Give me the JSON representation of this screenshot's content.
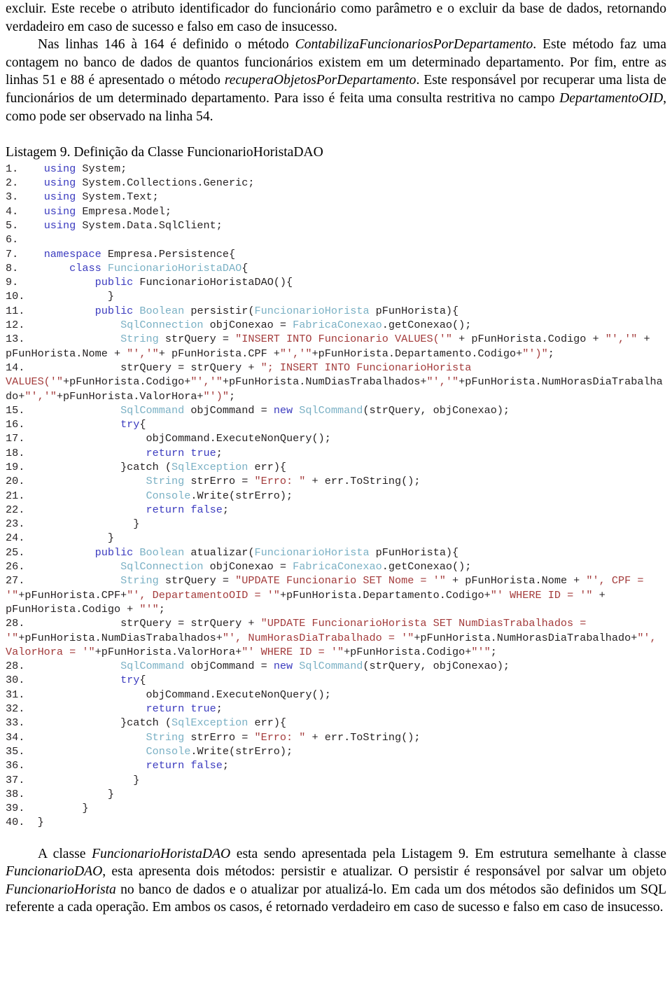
{
  "colors": {
    "keyword": "#3b3bbf",
    "type": "#7ab0c4",
    "string": "#a33b3b",
    "plain": "#231f20",
    "background": "#ffffff"
  },
  "intro": {
    "paragraph_1_part_1": "excluir. Este recebe o atributo identificador do funcionário como parâmetro e o excluir da base de dados, retornando verdadeiro em caso de sucesso e falso em caso de insucesso.",
    "paragraph_2_seg_1": "Nas linhas 146 à 164 é definido o método ",
    "paragraph_2_italic_1": "ContabilizaFuncionariosPorDepartamento",
    "paragraph_2_seg_2": ". Este método faz uma contagem no banco de dados de quantos funcionários existem em um determinado departamento. Por fim, entre as linhas 51 e 88 é apresentado o método ",
    "paragraph_2_italic_2": "recuperaObjetosPorDepartamento",
    "paragraph_2_seg_3": ". Este responsável por recuperar uma lista de funcionários de um determinado departamento. Para isso é feita uma consulta restritiva no campo ",
    "paragraph_2_italic_3": "DepartamentoOID",
    "paragraph_2_seg_4": ", como pode ser observado na linha 54."
  },
  "listing": {
    "title": "Listagem 9. Definição da Classe FuncionarioHoristaDAO",
    "lines": [
      {
        "num": "1.",
        "indent": 2,
        "tokens": [
          {
            "t": "kw",
            "s": "using"
          },
          {
            "t": "pl",
            "s": " System;"
          }
        ]
      },
      {
        "num": "2.",
        "indent": 2,
        "tokens": [
          {
            "t": "kw",
            "s": "using"
          },
          {
            "t": "pl",
            "s": " System.Collections.Generic;"
          }
        ]
      },
      {
        "num": "3.",
        "indent": 2,
        "tokens": [
          {
            "t": "kw",
            "s": "using"
          },
          {
            "t": "pl",
            "s": " System.Text;"
          }
        ]
      },
      {
        "num": "4.",
        "indent": 2,
        "tokens": [
          {
            "t": "kw",
            "s": "using"
          },
          {
            "t": "pl",
            "s": " Empresa.Model;"
          }
        ]
      },
      {
        "num": "5.",
        "indent": 2,
        "tokens": [
          {
            "t": "kw",
            "s": "using"
          },
          {
            "t": "pl",
            "s": " System.Data.SqlClient;"
          }
        ]
      },
      {
        "num": "6.",
        "indent": 0,
        "tokens": []
      },
      {
        "num": "7.",
        "indent": 2,
        "tokens": [
          {
            "t": "kw",
            "s": "namespace"
          },
          {
            "t": "pl",
            "s": " Empresa.Persistence{"
          }
        ]
      },
      {
        "num": "8.",
        "indent": 6,
        "tokens": [
          {
            "t": "kw",
            "s": "class"
          },
          {
            "t": "pl",
            "s": " "
          },
          {
            "t": "typ",
            "s": "FuncionarioHoristaDAO"
          },
          {
            "t": "pl",
            "s": "{"
          }
        ]
      },
      {
        "num": "9.",
        "indent": 10,
        "tokens": [
          {
            "t": "kw",
            "s": "public"
          },
          {
            "t": "pl",
            "s": " FuncionarioHoristaDAO(){"
          }
        ]
      },
      {
        "num": "10.",
        "indent": 12,
        "tokens": [
          {
            "t": "pl",
            "s": "}"
          }
        ]
      },
      {
        "num": "11.",
        "indent": 10,
        "tokens": [
          {
            "t": "kw",
            "s": "public"
          },
          {
            "t": "pl",
            "s": " "
          },
          {
            "t": "typ",
            "s": "Boolean"
          },
          {
            "t": "pl",
            "s": " persistir("
          },
          {
            "t": "typ",
            "s": "FuncionarioHorista"
          },
          {
            "t": "pl",
            "s": " pFunHorista){"
          }
        ]
      },
      {
        "num": "12.",
        "indent": 14,
        "tokens": [
          {
            "t": "typ",
            "s": "SqlConnection"
          },
          {
            "t": "pl",
            "s": " objConexao = "
          },
          {
            "t": "typ",
            "s": "FabricaConexao"
          },
          {
            "t": "pl",
            "s": ".getConexao();"
          }
        ]
      },
      {
        "num": "13.",
        "indent": 14,
        "tokens": [
          {
            "t": "typ",
            "s": "String"
          },
          {
            "t": "pl",
            "s": " strQuery = "
          },
          {
            "t": "str",
            "s": "\"INSERT INTO Funcionario VALUES('\""
          },
          {
            "t": "pl",
            "s": " + pFunHorista.Codigo + "
          },
          {
            "t": "str",
            "s": "\"','\""
          },
          {
            "t": "pl",
            "s": " + pFunHorista.Nome + "
          },
          {
            "t": "str",
            "s": "\"','\""
          },
          {
            "t": "pl",
            "s": "+ pFunHorista.CPF +"
          },
          {
            "t": "str",
            "s": "\"','\""
          },
          {
            "t": "pl",
            "s": "+pFunHorista.Departamento.Codigo+"
          },
          {
            "t": "str",
            "s": "\"')\""
          },
          {
            "t": "pl",
            "s": ";"
          }
        ]
      },
      {
        "num": "14.",
        "indent": 14,
        "tokens": [
          {
            "t": "pl",
            "s": "strQuery = strQuery + "
          },
          {
            "t": "str",
            "s": "\"; INSERT INTO FuncionarioHorista VALUES('\""
          },
          {
            "t": "pl",
            "s": "+pFunHorista.Codigo+"
          },
          {
            "t": "str",
            "s": "\"','\""
          },
          {
            "t": "pl",
            "s": "+pFunHorista.NumDiasTrabalhados+"
          },
          {
            "t": "str",
            "s": "\"','\""
          },
          {
            "t": "pl",
            "s": "+pFunHorista.NumHorasDiaTrabalhado+"
          },
          {
            "t": "str",
            "s": "\"','\""
          },
          {
            "t": "pl",
            "s": "+pFunHorista.ValorHora+"
          },
          {
            "t": "str",
            "s": "\"')\""
          },
          {
            "t": "pl",
            "s": ";"
          }
        ]
      },
      {
        "num": "15.",
        "indent": 14,
        "tokens": [
          {
            "t": "typ",
            "s": "SqlCommand"
          },
          {
            "t": "pl",
            "s": " objCommand = "
          },
          {
            "t": "kw",
            "s": "new"
          },
          {
            "t": "pl",
            "s": " "
          },
          {
            "t": "typ",
            "s": "SqlCommand"
          },
          {
            "t": "pl",
            "s": "(strQuery, objConexao);"
          }
        ]
      },
      {
        "num": "16.",
        "indent": 14,
        "tokens": [
          {
            "t": "kw",
            "s": "try"
          },
          {
            "t": "pl",
            "s": "{"
          }
        ]
      },
      {
        "num": "17.",
        "indent": 18,
        "tokens": [
          {
            "t": "pl",
            "s": "objCommand.ExecuteNonQuery();"
          }
        ]
      },
      {
        "num": "18.",
        "indent": 18,
        "tokens": [
          {
            "t": "kw",
            "s": "return"
          },
          {
            "t": "pl",
            "s": " "
          },
          {
            "t": "kw",
            "s": "true"
          },
          {
            "t": "pl",
            "s": ";"
          }
        ]
      },
      {
        "num": "19.",
        "indent": 14,
        "tokens": [
          {
            "t": "pl",
            "s": "}catch ("
          },
          {
            "t": "typ",
            "s": "SqlException"
          },
          {
            "t": "pl",
            "s": " err){"
          }
        ]
      },
      {
        "num": "20.",
        "indent": 18,
        "tokens": [
          {
            "t": "typ",
            "s": "String"
          },
          {
            "t": "pl",
            "s": " strErro = "
          },
          {
            "t": "str",
            "s": "\"Erro: \""
          },
          {
            "t": "pl",
            "s": " + err.ToString();"
          }
        ]
      },
      {
        "num": "21.",
        "indent": 18,
        "tokens": [
          {
            "t": "typ",
            "s": "Console"
          },
          {
            "t": "pl",
            "s": ".Write(strErro);"
          }
        ]
      },
      {
        "num": "22.",
        "indent": 18,
        "tokens": [
          {
            "t": "kw",
            "s": "return"
          },
          {
            "t": "pl",
            "s": " "
          },
          {
            "t": "kw",
            "s": "false"
          },
          {
            "t": "pl",
            "s": ";"
          }
        ]
      },
      {
        "num": "23.",
        "indent": 16,
        "tokens": [
          {
            "t": "pl",
            "s": "}"
          }
        ]
      },
      {
        "num": "24.",
        "indent": 12,
        "tokens": [
          {
            "t": "pl",
            "s": "}"
          }
        ]
      },
      {
        "num": "25.",
        "indent": 10,
        "tokens": [
          {
            "t": "kw",
            "s": "public"
          },
          {
            "t": "pl",
            "s": " "
          },
          {
            "t": "typ",
            "s": "Boolean"
          },
          {
            "t": "pl",
            "s": " atualizar("
          },
          {
            "t": "typ",
            "s": "FuncionarioHorista"
          },
          {
            "t": "pl",
            "s": " pFunHorista){"
          }
        ]
      },
      {
        "num": "26.",
        "indent": 14,
        "tokens": [
          {
            "t": "typ",
            "s": "SqlConnection"
          },
          {
            "t": "pl",
            "s": " objConexao = "
          },
          {
            "t": "typ",
            "s": "FabricaConexao"
          },
          {
            "t": "pl",
            "s": ".getConexao();"
          }
        ]
      },
      {
        "num": "27.",
        "indent": 14,
        "tokens": [
          {
            "t": "typ",
            "s": "String"
          },
          {
            "t": "pl",
            "s": " strQuery = "
          },
          {
            "t": "str",
            "s": "\"UPDATE Funcionario SET Nome = '\""
          },
          {
            "t": "pl",
            "s": " + pFunHorista.Nome + "
          },
          {
            "t": "str",
            "s": "\"', CPF = '\""
          },
          {
            "t": "pl",
            "s": "+pFunHorista.CPF+"
          },
          {
            "t": "str",
            "s": "\"', DepartamentoOID = '\""
          },
          {
            "t": "pl",
            "s": "+pFunHorista.Departamento.Codigo+"
          },
          {
            "t": "str",
            "s": "\"' WHERE ID = '\""
          },
          {
            "t": "pl",
            "s": " + pFunHorista.Codigo + "
          },
          {
            "t": "str",
            "s": "\"'\""
          },
          {
            "t": "pl",
            "s": ";"
          }
        ]
      },
      {
        "num": "28.",
        "indent": 14,
        "tokens": [
          {
            "t": "pl",
            "s": "strQuery = strQuery + "
          },
          {
            "t": "str",
            "s": "\"UPDATE FuncionarioHorista SET NumDiasTrabalhados = '\""
          },
          {
            "t": "pl",
            "s": "+pFunHorista.NumDiasTrabalhados+"
          },
          {
            "t": "str",
            "s": "\"', NumHorasDiaTrabalhado = '\""
          },
          {
            "t": "pl",
            "s": "+pFunHorista.NumHorasDiaTrabalhado+"
          },
          {
            "t": "str",
            "s": "\"', ValorHora = '\""
          },
          {
            "t": "pl",
            "s": "+pFunHorista.ValorHora+"
          },
          {
            "t": "str",
            "s": "\"' WHERE ID = '\""
          },
          {
            "t": "pl",
            "s": "+pFunHorista.Codigo+"
          },
          {
            "t": "str",
            "s": "\"'\""
          },
          {
            "t": "pl",
            "s": ";"
          }
        ]
      },
      {
        "num": "28.",
        "indent": 14,
        "tokens": [
          {
            "t": "typ",
            "s": "SqlCommand"
          },
          {
            "t": "pl",
            "s": " objCommand = "
          },
          {
            "t": "kw",
            "s": "new"
          },
          {
            "t": "pl",
            "s": " "
          },
          {
            "t": "typ",
            "s": "SqlCommand"
          },
          {
            "t": "pl",
            "s": "(strQuery, objConexao);"
          }
        ]
      },
      {
        "num": "30.",
        "indent": 14,
        "tokens": [
          {
            "t": "kw",
            "s": "try"
          },
          {
            "t": "pl",
            "s": "{"
          }
        ]
      },
      {
        "num": "31.",
        "indent": 18,
        "tokens": [
          {
            "t": "pl",
            "s": "objCommand.ExecuteNonQuery();"
          }
        ]
      },
      {
        "num": "32.",
        "indent": 18,
        "tokens": [
          {
            "t": "kw",
            "s": "return"
          },
          {
            "t": "pl",
            "s": " "
          },
          {
            "t": "kw",
            "s": "true"
          },
          {
            "t": "pl",
            "s": ";"
          }
        ]
      },
      {
        "num": "33.",
        "indent": 14,
        "tokens": [
          {
            "t": "pl",
            "s": "}catch ("
          },
          {
            "t": "typ",
            "s": "SqlException"
          },
          {
            "t": "pl",
            "s": " err){"
          }
        ]
      },
      {
        "num": "34.",
        "indent": 18,
        "tokens": [
          {
            "t": "typ",
            "s": "String"
          },
          {
            "t": "pl",
            "s": " strErro = "
          },
          {
            "t": "str",
            "s": "\"Erro: \""
          },
          {
            "t": "pl",
            "s": " + err.ToString();"
          }
        ]
      },
      {
        "num": "35.",
        "indent": 18,
        "tokens": [
          {
            "t": "typ",
            "s": "Console"
          },
          {
            "t": "pl",
            "s": ".Write(strErro);"
          }
        ]
      },
      {
        "num": "36.",
        "indent": 18,
        "tokens": [
          {
            "t": "kw",
            "s": "return"
          },
          {
            "t": "pl",
            "s": " "
          },
          {
            "t": "kw",
            "s": "false"
          },
          {
            "t": "pl",
            "s": ";"
          }
        ]
      },
      {
        "num": "37.",
        "indent": 16,
        "tokens": [
          {
            "t": "pl",
            "s": "}"
          }
        ]
      },
      {
        "num": "38.",
        "indent": 12,
        "tokens": [
          {
            "t": "pl",
            "s": "}"
          }
        ]
      },
      {
        "num": "39.",
        "indent": 8,
        "tokens": [
          {
            "t": "pl",
            "s": "}"
          }
        ]
      },
      {
        "num": "40.",
        "indent": 1,
        "tokens": [
          {
            "t": "pl",
            "s": "}"
          }
        ]
      }
    ]
  },
  "outro": {
    "seg_1": "A classe ",
    "italic_1": "FuncionarioHoristaDAO",
    "seg_2": " esta sendo apresentada pela Listagem 9. Em estrutura semelhante à classe ",
    "italic_2": "FuncionarioDAO",
    "seg_3": ", esta apresenta dois métodos: persistir e atualizar. O persistir é responsável por salvar um objeto ",
    "italic_3": "FuncionarioHorista",
    "seg_4": " no banco de dados e o atualizar por atualizá-lo. Em cada um dos métodos são definidos um SQL referente a cada operação. Em ambos os casos, é retornado verdadeiro em caso de sucesso e falso em caso de insucesso."
  }
}
